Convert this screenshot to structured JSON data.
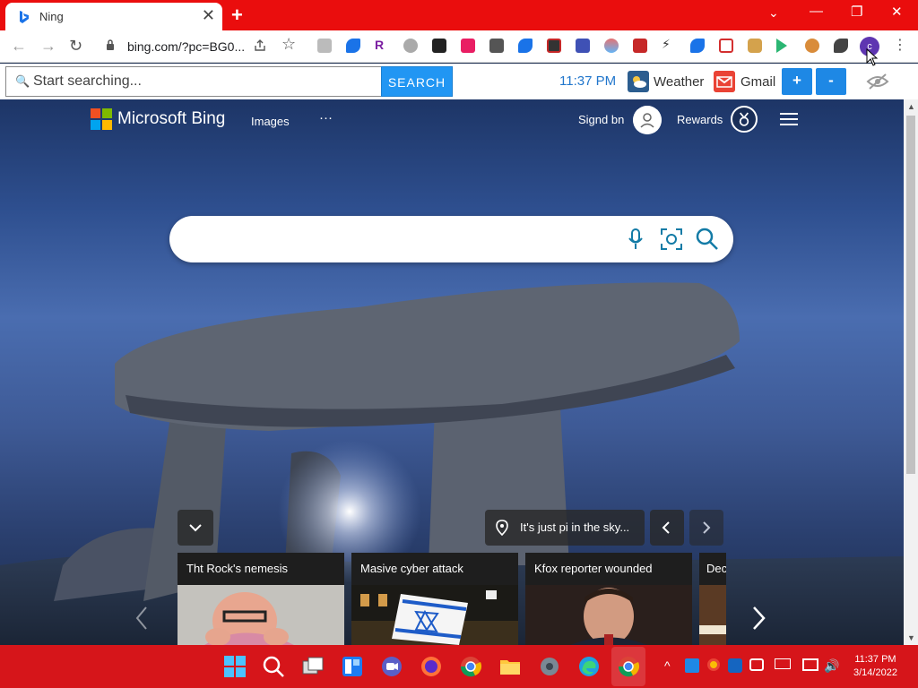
{
  "browser": {
    "tab_title": "Ning",
    "tab_close": "✕",
    "new_tab": "+",
    "url": "bing.com/?pc=BG0...",
    "win_min": "—",
    "win_max": "❐",
    "win_close": "✕",
    "dropdown": "⌄"
  },
  "toolbar": {
    "search_placeholder": "Start searching...",
    "search_button": "SEARCH",
    "clock": "11:37 PM",
    "weather_label": "Weather",
    "gmail_label": "Gmail",
    "zoom_in": "+",
    "zoom_out": "-",
    "profile_initial": "c"
  },
  "bing": {
    "brand": "Microsoft Bing",
    "nav_images": "Images",
    "nav_more": "···",
    "signed_in": "Signd bn",
    "rewards": "Rewards",
    "image_caption": "It's just pi in the sky...",
    "news": [
      {
        "title": "Tht Rock's nemesis"
      },
      {
        "title": "Masive cyber attack"
      },
      {
        "title": "Kfox reporter wounded"
      },
      {
        "title": "Dec"
      }
    ]
  },
  "taskbar": {
    "time": "11:37 PM",
    "date": "3/14/2022",
    "tray_chevron": "^"
  },
  "colors": {
    "tab_bar": "#ea0d0d",
    "taskbar": "#d6151a",
    "search_button": "#2196f3",
    "zoom_buttons": "#1e88e5"
  }
}
